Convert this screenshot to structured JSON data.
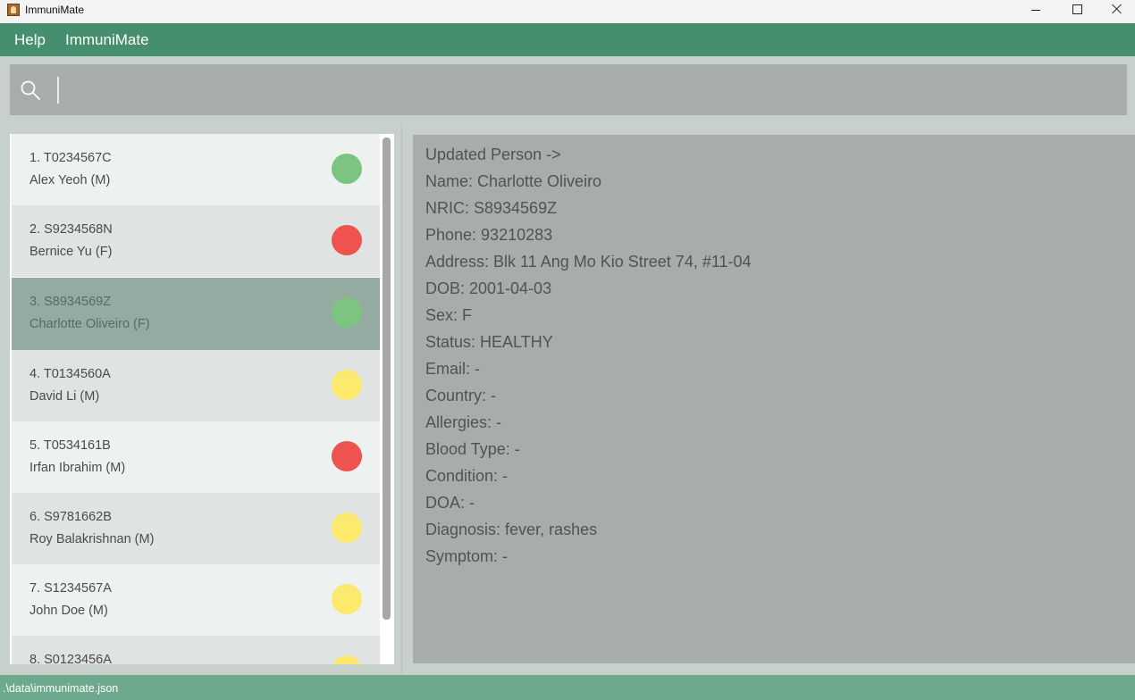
{
  "window": {
    "title": "ImmuniMate"
  },
  "menu": {
    "items": [
      "Help",
      "ImmuniMate"
    ]
  },
  "search": {
    "value": "",
    "placeholder": ""
  },
  "colors": {
    "menubar": "#468f6e",
    "statusbar": "#6ca98d",
    "green": "#7cc47f",
    "red": "#ee5350",
    "yellow": "#fde96b"
  },
  "persons": [
    {
      "index": "1.",
      "nric": "T0234567C",
      "name": "Alex Yeoh (M)",
      "status": "green"
    },
    {
      "index": "2.",
      "nric": "S9234568N",
      "name": "Bernice Yu (F)",
      "status": "red"
    },
    {
      "index": "3.",
      "nric": "S8934569Z",
      "name": "Charlotte Oliveiro (F)",
      "status": "green",
      "selected": true
    },
    {
      "index": "4.",
      "nric": "T0134560A",
      "name": "David Li (M)",
      "status": "yellow"
    },
    {
      "index": "5.",
      "nric": "T0534161B",
      "name": "Irfan Ibrahim (M)",
      "status": "red"
    },
    {
      "index": "6.",
      "nric": "S9781662B",
      "name": "Roy Balakrishnan (M)",
      "status": "yellow"
    },
    {
      "index": "7.",
      "nric": "S1234567A",
      "name": "John Doe (M)",
      "status": "yellow"
    },
    {
      "index": "8.",
      "nric": "S0123456A",
      "name": "",
      "status": "yellow"
    }
  ],
  "detail": {
    "lines": [
      "Updated Person ->",
      "Name: Charlotte Oliveiro",
      "NRIC: S8934569Z",
      "Phone: 93210283",
      "Address: Blk 11 Ang Mo Kio Street 74, #11-04",
      "DOB: 2001-04-03",
      "Sex: F",
      "Status: HEALTHY",
      "Email: -",
      "Country: -",
      "Allergies: -",
      "Blood Type: -",
      "Condition: -",
      "DOA: -",
      "Diagnosis: fever, rashes",
      "Symptom: -"
    ]
  },
  "statusbar": {
    "path": ".\\data\\immunimate.json"
  }
}
